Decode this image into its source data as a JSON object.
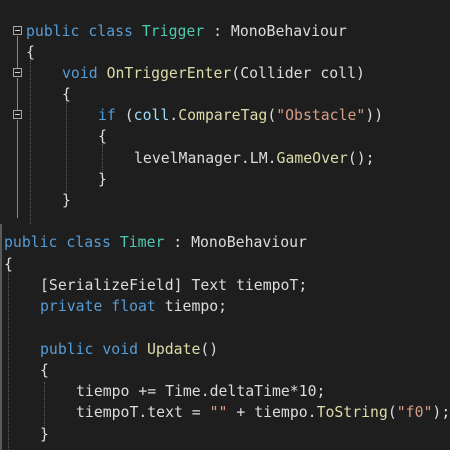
{
  "editor": {
    "colors": {
      "background": "#1e1e1e",
      "keyword": "#569cd6",
      "type": "#4ec9b0",
      "method": "#dcdcaa",
      "plain": "#dcdcdc",
      "string": "#d69d85",
      "parameter": "#9cdcfe"
    },
    "top_panel": [
      [
        {
          "t": "public",
          "c": "kw"
        },
        {
          "t": " "
        },
        {
          "t": "class",
          "c": "kw"
        },
        {
          "t": " "
        },
        {
          "t": "Trigger",
          "c": "ty"
        },
        {
          "t": " : MonoBehaviour"
        }
      ],
      [
        {
          "t": "{"
        }
      ],
      [
        {
          "t": "void",
          "c": "kw"
        },
        {
          "t": " "
        },
        {
          "t": "OnTriggerEnter",
          "c": "fn"
        },
        {
          "t": "(Collider coll)"
        }
      ],
      [
        {
          "t": "{"
        }
      ],
      [
        {
          "t": "if",
          "c": "kw"
        },
        {
          "t": " ("
        },
        {
          "t": "coll",
          "c": "pa"
        },
        {
          "t": "."
        },
        {
          "t": "CompareTag",
          "c": "fn"
        },
        {
          "t": "("
        },
        {
          "t": "\"Obstacle\"",
          "c": "st"
        },
        {
          "t": "))"
        }
      ],
      [
        {
          "t": "{"
        }
      ],
      [
        {
          "t": "levelManager.LM."
        },
        {
          "t": "GameOver",
          "c": "fn"
        },
        {
          "t": "();"
        }
      ],
      [
        {
          "t": "}"
        }
      ],
      [
        {
          "t": "}"
        }
      ]
    ],
    "bottom_panel": [
      [
        {
          "t": "public",
          "c": "kw"
        },
        {
          "t": " "
        },
        {
          "t": "class",
          "c": "kw"
        },
        {
          "t": " "
        },
        {
          "t": "Timer",
          "c": "ty"
        },
        {
          "t": " : MonoBehaviour"
        }
      ],
      [
        {
          "t": "{"
        }
      ],
      [
        {
          "t": "[SerializeField] Text tiempoT;"
        }
      ],
      [
        {
          "t": "private",
          "c": "kw"
        },
        {
          "t": " "
        },
        {
          "t": "float",
          "c": "kw"
        },
        {
          "t": " tiempo;"
        }
      ],
      [],
      [
        {
          "t": "public",
          "c": "kw"
        },
        {
          "t": " "
        },
        {
          "t": "void",
          "c": "kw"
        },
        {
          "t": " "
        },
        {
          "t": "Update",
          "c": "fn"
        },
        {
          "t": "()"
        }
      ],
      [
        {
          "t": "{"
        }
      ],
      [
        {
          "t": "tiempo += Time.deltaTime*10;"
        }
      ],
      [
        {
          "t": "tiempoT.text = "
        },
        {
          "t": "\"\"",
          "c": "st"
        },
        {
          "t": " + tiempo."
        },
        {
          "t": "ToString",
          "c": "fn"
        },
        {
          "t": "("
        },
        {
          "t": "\"f0\"",
          "c": "st"
        },
        {
          "t": ");"
        }
      ],
      [
        {
          "t": "}"
        }
      ]
    ]
  }
}
